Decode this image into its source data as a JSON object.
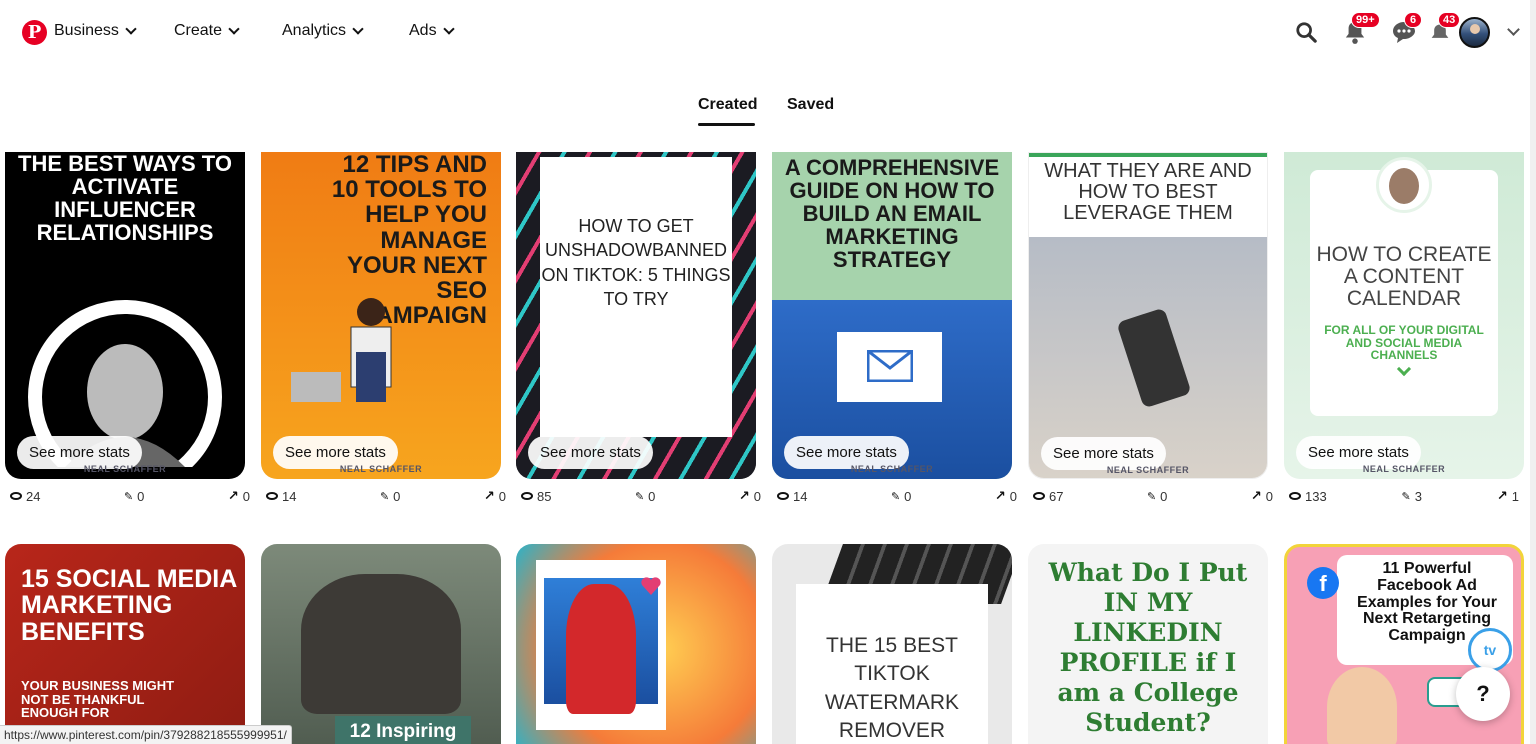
{
  "nav": {
    "logo": "P",
    "items": [
      {
        "label": "Business"
      },
      {
        "label": "Create"
      },
      {
        "label": "Analytics"
      },
      {
        "label": "Ads"
      }
    ],
    "notifications_badge": "99+",
    "messages_badge": "6",
    "updates_badge": "43"
  },
  "tabs": {
    "created": "Created",
    "saved": "Saved"
  },
  "see_more_label": "See more stats",
  "brand_label": "NEAL SCHAFFER",
  "row1": [
    {
      "title": "THE BEST WAYS TO ACTIVATE INFLUENCER RELATIONSHIPS",
      "views": "24",
      "saves": "0",
      "clicks": "0",
      "bg": "#000000",
      "fg": "#ffffff"
    },
    {
      "title": "12 TIPS AND 10 TOOLS TO HELP YOU MANAGE YOUR NEXT SEO CAMPAIGN",
      "views": "14",
      "saves": "0",
      "clicks": "0",
      "bg": "#f0891a",
      "fg": "#1a1a1a"
    },
    {
      "title": "HOW TO GET UNSHADOWBANNED ON TIKTOK: 5 THINGS TO TRY",
      "views": "85",
      "saves": "0",
      "clicks": "0",
      "bg": "#1b1b22",
      "fg": "#222222"
    },
    {
      "title": "A COMPREHENSIVE GUIDE ON HOW TO BUILD AN EMAIL MARKETING STRATEGY",
      "views": "14",
      "saves": "0",
      "clicks": "0",
      "bg": "#a6d3ac",
      "fg": "#1a1a1a"
    },
    {
      "title": "WHAT THEY ARE AND HOW TO BEST LEVERAGE THEM",
      "views": "67",
      "saves": "0",
      "clicks": "0",
      "bg": "#ffffff",
      "fg": "#333333"
    },
    {
      "title": "HOW TO CREATE A CONTENT CALENDAR",
      "subtitle": "FOR ALL OF YOUR DIGITAL AND SOCIAL MEDIA CHANNELS",
      "views": "133",
      "saves": "3",
      "clicks": "1",
      "bg": "#d7eedc",
      "fg": "#333333"
    }
  ],
  "row2": [
    {
      "title": "15 SOCIAL MEDIA MARKETING BENEFITS",
      "subtitle": "YOUR BUSINESS MIGHT NOT BE THANKFUL ENOUGH FOR",
      "bg": "#a32014",
      "fg": "#ffffff"
    },
    {
      "title": "12 Inspiring",
      "bg": "#6f7d6e",
      "fg": "#ffffff"
    },
    {
      "title": "",
      "bg": "#f57b39",
      "fg": "#ffffff"
    },
    {
      "title": "THE 15 BEST TIKTOK WATERMARK REMOVER",
      "bg": "#e9e9e9",
      "fg": "#333333"
    },
    {
      "title": "What Do I Put IN MY LINKEDIN PROFILE if I am a College Student?",
      "bg": "#f4f4f4",
      "fg": "#2e7d32"
    },
    {
      "title": "11 Powerful Facebook Ad Examples for Your Next Retargeting Campaign",
      "bg": "#f7a0b5",
      "fg": "#111111"
    }
  ],
  "help_label": "?",
  "tv_label": "tv",
  "status_url": "https://www.pinterest.com/pin/379288218555999951/"
}
